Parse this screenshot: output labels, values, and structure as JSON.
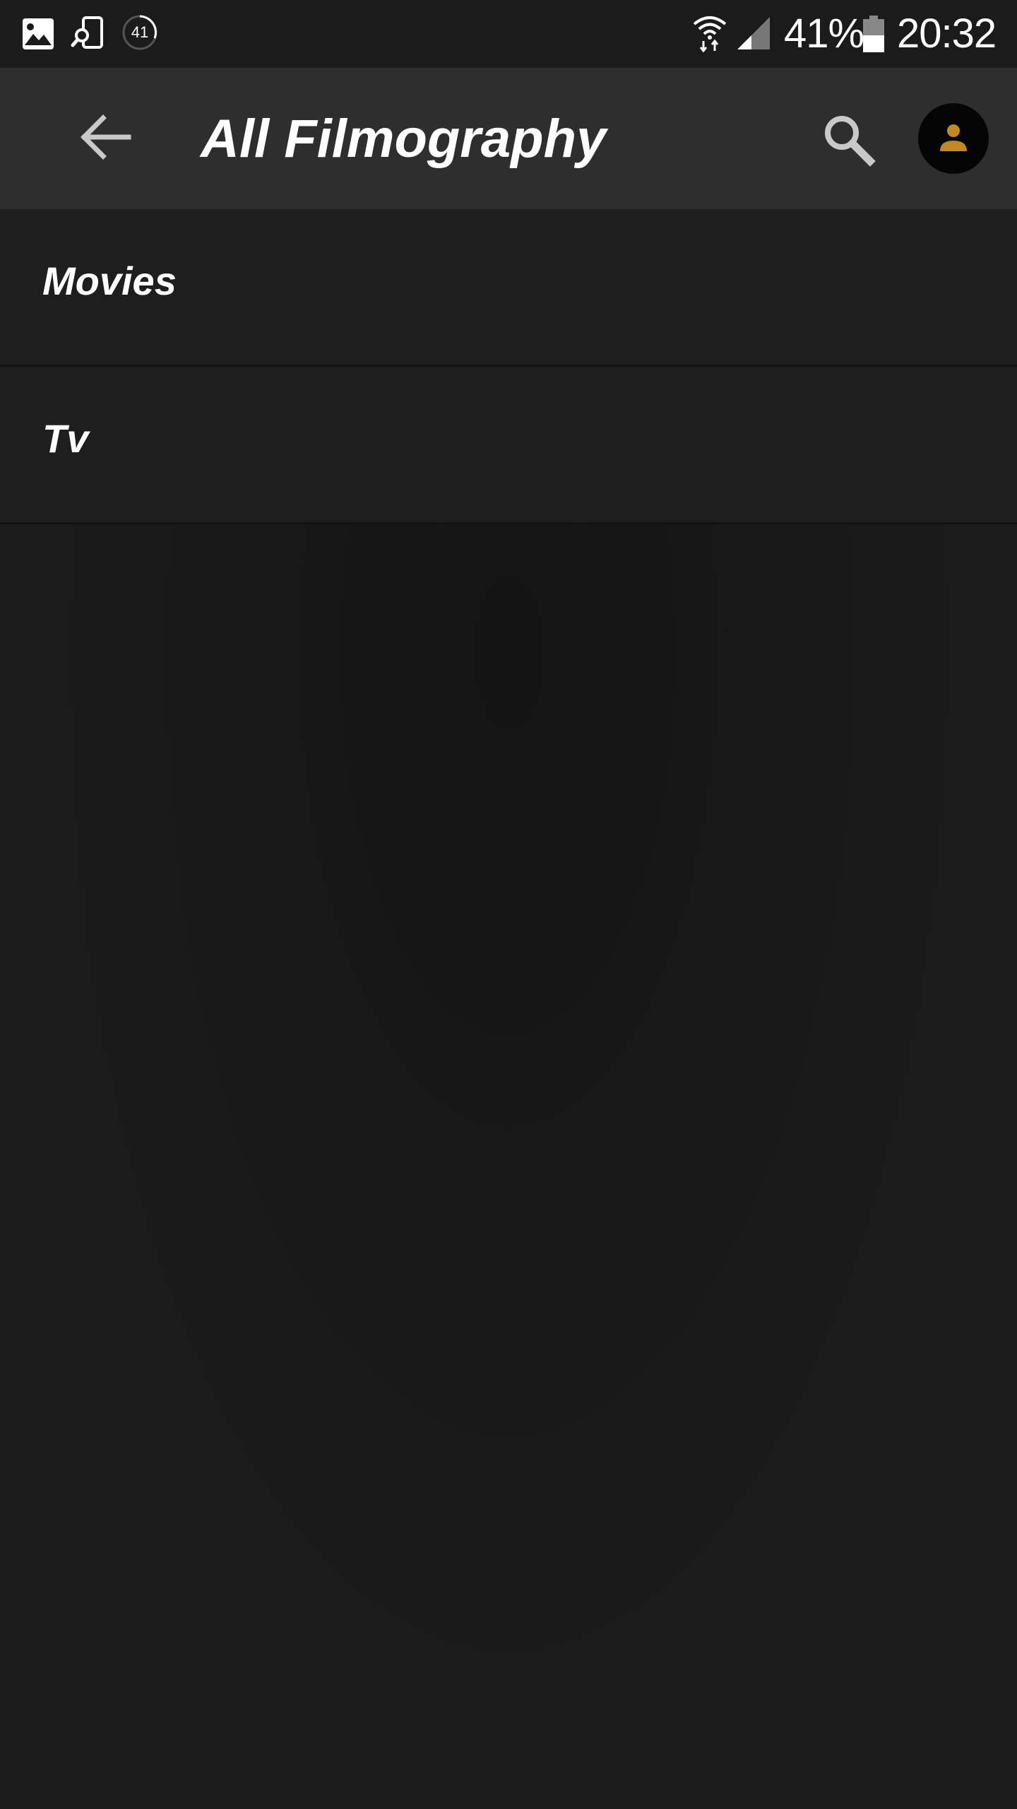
{
  "status_bar": {
    "notification_icons": [
      "gallery-icon",
      "phone-search-icon",
      "progress-circle-icon"
    ],
    "progress_badge": "41",
    "battery_percent": "41%",
    "time": "20:32",
    "icons": [
      "wifi-icon",
      "signal-icon",
      "battery-icon"
    ]
  },
  "app_bar": {
    "title": "All Filmography",
    "back_icon": "arrow-left-icon",
    "search_icon": "search-icon",
    "profile_icon": "person-icon"
  },
  "list": {
    "items": [
      {
        "label": "Movies"
      },
      {
        "label": "Tv"
      }
    ]
  },
  "colors": {
    "background": "#1b1b1b",
    "app_bar": "#2e2e2e",
    "list_item": "#1e1e1e",
    "accent": "#c08a1e"
  }
}
